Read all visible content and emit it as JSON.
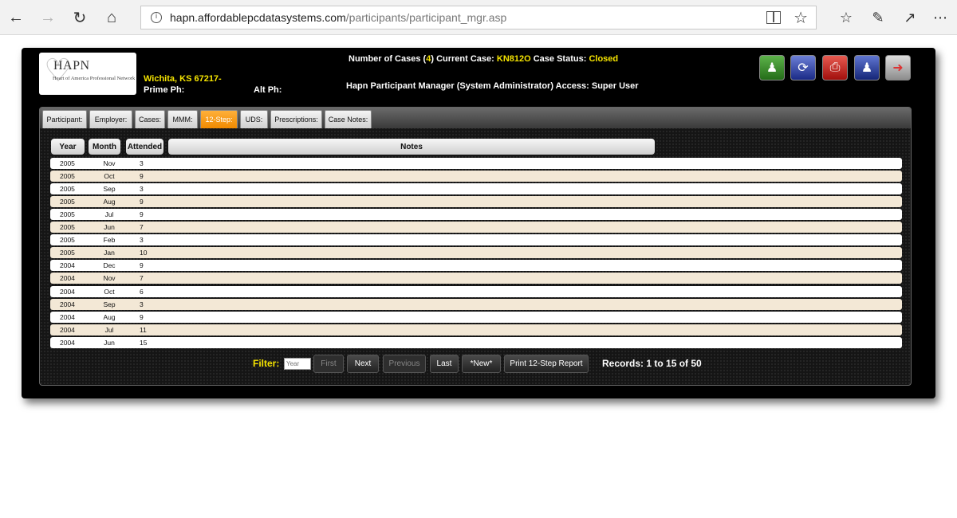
{
  "browser": {
    "url_host": "hapn.affordablepcdatasystems.com",
    "url_path": "/participants/participant_mgr.asp"
  },
  "logo": {
    "title": "HAPN",
    "subtitle": "Heart of America Professional Network"
  },
  "participant": {
    "city": "Wichita, KS 67217-",
    "prime_ph_label": "Prime Ph:",
    "alt_ph_label": "Alt Ph:"
  },
  "header": {
    "num_cases_label": "Number of Cases (",
    "num_cases_value": "4",
    "num_cases_close": ")",
    "current_case_label": "Current Case:",
    "current_case_value": "KN812O",
    "case_status_label": "Case Status:",
    "case_status_value": "Closed",
    "access_line": "Hapn Participant Manager (System Administrator) Access: Super User"
  },
  "tabs": [
    {
      "label": "Participant:"
    },
    {
      "label": "Employer:"
    },
    {
      "label": "Cases:"
    },
    {
      "label": "MMM:"
    },
    {
      "label": "12-Step:"
    },
    {
      "label": "UDS:"
    },
    {
      "label": "Prescriptions:"
    },
    {
      "label": "Case Notes:"
    }
  ],
  "columns": {
    "year": "Year",
    "month": "Month",
    "attended": "Attended",
    "notes": "Notes"
  },
  "rows": [
    {
      "year": "2005",
      "month": "Nov",
      "attended": "3"
    },
    {
      "year": "2005",
      "month": "Oct",
      "attended": "9"
    },
    {
      "year": "2005",
      "month": "Sep",
      "attended": "3"
    },
    {
      "year": "2005",
      "month": "Aug",
      "attended": "9"
    },
    {
      "year": "2005",
      "month": "Jul",
      "attended": "9"
    },
    {
      "year": "2005",
      "month": "Jun",
      "attended": "7"
    },
    {
      "year": "2005",
      "month": "Feb",
      "attended": "3"
    },
    {
      "year": "2005",
      "month": "Jan",
      "attended": "10"
    },
    {
      "year": "2004",
      "month": "Dec",
      "attended": "9"
    },
    {
      "year": "2004",
      "month": "Nov",
      "attended": "7"
    },
    {
      "year": "2004",
      "month": "Oct",
      "attended": "6"
    },
    {
      "year": "2004",
      "month": "Sep",
      "attended": "3"
    },
    {
      "year": "2004",
      "month": "Aug",
      "attended": "9"
    },
    {
      "year": "2004",
      "month": "Jul",
      "attended": "11"
    },
    {
      "year": "2004",
      "month": "Jun",
      "attended": "15"
    }
  ],
  "pager": {
    "filter_label": "Filter:",
    "filter_placeholder": "Year",
    "first": "First",
    "next": "Next",
    "previous": "Previous",
    "last": "Last",
    "new": "*New*",
    "print": "Print 12-Step Report",
    "records": "Records: 1 to 15 of 50"
  }
}
